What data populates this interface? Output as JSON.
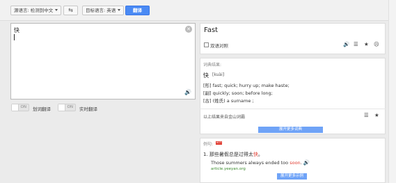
{
  "toolbar": {
    "source_lang": "源语言: 检测到中文",
    "swap_icon": "swap-arrows-icon",
    "target_lang": "目标语言: 英语",
    "translate_label": "翻译"
  },
  "source": {
    "text": "快"
  },
  "toggles": [
    {
      "state": "ON",
      "label": "划词翻译"
    },
    {
      "state": "ON",
      "label": "实时翻译"
    }
  ],
  "result": {
    "main": "Fast",
    "phrase_checkbox_label": "双语对照"
  },
  "dictionary": {
    "header": "词典结果:",
    "word": "快",
    "pinyin": "[kuài]",
    "definitions": [
      "[形] fast; quick; hurry up; make haste;",
      "[副] quickly; soon; before long;",
      "[古] (姓氏) a surname ;"
    ],
    "source_note": "以上结果来自金山词霸",
    "more_label": "展开更多词典"
  },
  "examples": {
    "header": "例句:",
    "hot_badge": "HOT",
    "items": [
      {
        "index": "1.",
        "cn_before": "那些暑假总是过得太",
        "cn_highlight": "快",
        "cn_after": "。",
        "en_before": "Those summers always ended too ",
        "en_highlight": "soon",
        "en_after": ".",
        "source": "article.yeeyan.org"
      }
    ],
    "more_label": "展开更多示例"
  },
  "colors": {
    "primary": "#4a8af4",
    "highlight": "#e03a2f",
    "source_link": "#3a8a2c"
  }
}
